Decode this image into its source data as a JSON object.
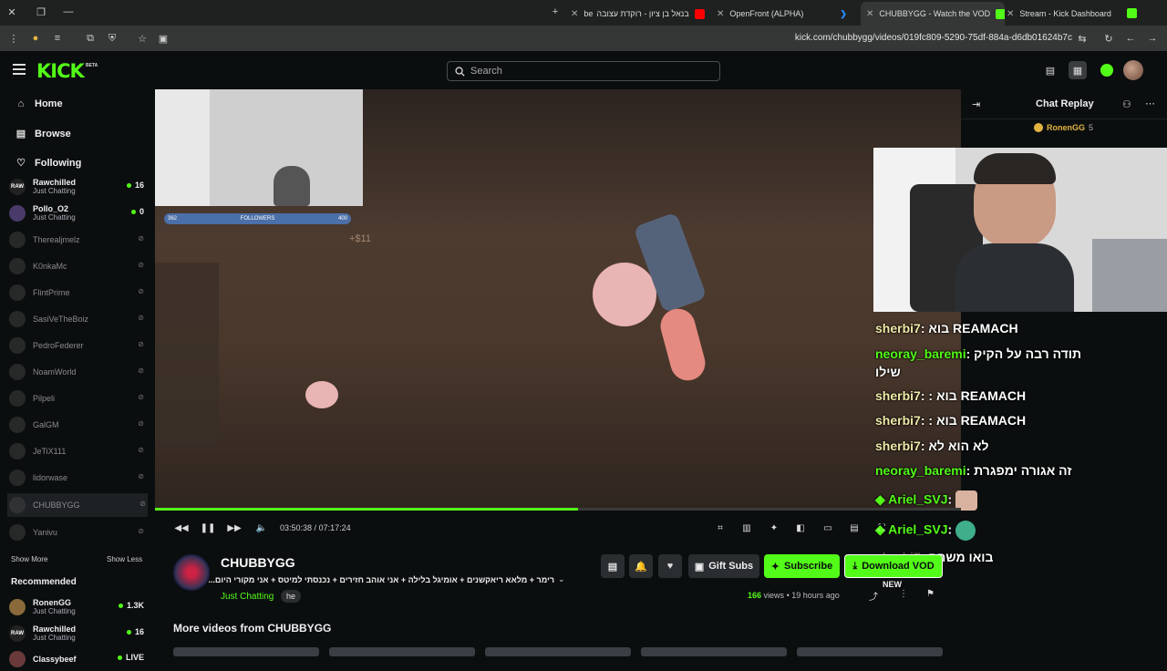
{
  "browser": {
    "tabs": [
      {
        "label": "בנאל בן ציון - רוקדת עצובה",
        "color": "#ff0000"
      },
      {
        "label": "OpenFront (ALPHA)",
        "color": "#2a6bd8"
      },
      {
        "label": "CHUBBYGG - Watch the VOD",
        "color": "#53fc18"
      },
      {
        "label": "Stream - Kick Dashboard",
        "color": "#53fc18"
      }
    ],
    "tab_prefix": "be",
    "url": "kick.com/chubbygg/videos/019fc809-5290-75df-884a-d6db01624b7c"
  },
  "header": {
    "logo": "KICK",
    "beta": "BETA",
    "search_placeholder": "Search"
  },
  "sidebar": {
    "nav": [
      {
        "label": "Home",
        "icon": "home-icon"
      },
      {
        "label": "Browse",
        "icon": "browse-icon"
      },
      {
        "label": "Following",
        "icon": "heart-icon"
      }
    ],
    "following": [
      {
        "name": "Rawchilled",
        "category": "Just Chatting",
        "viewers": "16",
        "live": true
      },
      {
        "name": "Pollo_O2",
        "category": "Just Chatting",
        "viewers": "0",
        "live": true
      },
      {
        "name": "Therealjmelz",
        "live": false
      },
      {
        "name": "K0nkaMc",
        "live": false
      },
      {
        "name": "FlintPrime",
        "live": false
      },
      {
        "name": "SasiVeTheBoiz",
        "live": false
      },
      {
        "name": "PedroFederer",
        "live": false
      },
      {
        "name": "NoamWorld",
        "live": false
      },
      {
        "name": "Pilpeli",
        "live": false
      },
      {
        "name": "GalGM",
        "live": false
      },
      {
        "name": "JeTiX111",
        "live": false
      },
      {
        "name": "lidorwase",
        "live": false
      },
      {
        "name": "CHUBBYGG",
        "live": false,
        "selected": true
      },
      {
        "name": "Yanivu",
        "live": false
      }
    ],
    "show_more": "Show More",
    "show_less": "Show Less",
    "recommended_title": "Recommended",
    "recommended": [
      {
        "name": "RonenGG",
        "category": "Just Chatting",
        "viewers": "1.3K"
      },
      {
        "name": "Rawchilled",
        "category": "Just Chatting",
        "viewers": "16"
      },
      {
        "name": "Classybeef",
        "category": "",
        "viewers": "LIVE"
      }
    ]
  },
  "video": {
    "followers_left": "362",
    "followers_label": "FOLLOWERS",
    "followers_right": "400",
    "overlay_text": "+$11",
    "time_current": "03:50:38",
    "time_total": "07:17:24",
    "progress": 0.525
  },
  "chat": {
    "title": "Chat Replay",
    "pinned_user": "RonenGG",
    "pinned_count": "5",
    "messages": [
      {
        "user": "sherbi7",
        "text": "בוא REAMACH",
        "style": "y"
      },
      {
        "user": "neoray_baremi",
        "text": "תודה רבה על הקיק",
        "text2": "שילו",
        "style": "g"
      },
      {
        "user": "sherbi7",
        "text": ": בוא REAMACH",
        "style": "y"
      },
      {
        "user": "sherbi7",
        "text": ": בוא REAMACH",
        "style": "y"
      },
      {
        "user": "sherbi7",
        "text": "לא הוא לא",
        "style": "y"
      },
      {
        "user": "neoray_baremi",
        "text": "זה אגורה ימפגרת",
        "style": "g"
      },
      {
        "user": "Ariel_SVJ",
        "text": "",
        "style": "g"
      },
      {
        "user": "Ariel_SVJ",
        "text": "",
        "style": "g"
      },
      {
        "user": "sherbi7",
        "text": "בואו משחק",
        "style": "y"
      }
    ]
  },
  "channel": {
    "name": "CHUBBYGG",
    "title": "רימר + מלאא ריאקשנים + אומיגל בלילה + אני אוהב חזירים + נכנסתי למיטס + אני מקורי היום...",
    "category": "Just Chatting",
    "tag": "he",
    "gift_subs": "Gift Subs",
    "subscribe": "Subscribe",
    "download": "Download VOD",
    "new_badge": "NEW",
    "views_count": "166",
    "views_label": "views",
    "age": "19 hours ago"
  },
  "more_videos_title": "More videos from CHUBBYGG",
  "colors": {
    "accent": "#53fc18",
    "bg": "#0b0e0f"
  }
}
